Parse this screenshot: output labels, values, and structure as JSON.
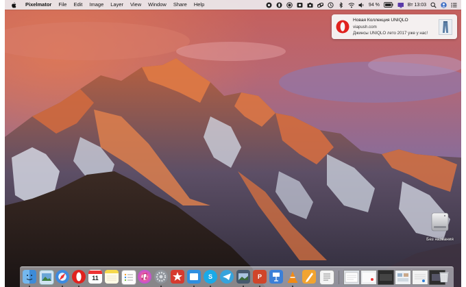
{
  "menubar": {
    "app_name": "Pixelmator",
    "menus": [
      "File",
      "Edit",
      "Image",
      "Layer",
      "View",
      "Window",
      "Share",
      "Help"
    ],
    "battery_text": "94 %",
    "clock": "Вт 13:03",
    "status_icons": [
      "pixelmator-status-icon",
      "opera-status-icon",
      "record-status-icon",
      "photo-booth-status-icon",
      "camera-status-icon",
      "link-status-icon",
      "time-machine-status-icon",
      "bluetooth-status-icon",
      "wifi-status-icon",
      "volume-status-icon",
      "battery-icon",
      "display-icon",
      "search-icon",
      "user-avatar-icon",
      "notification-center-icon"
    ]
  },
  "notification": {
    "app_icon": "opera-icon",
    "title": "Новая Коллекция UNIQLO",
    "subtitle": "viapush.com",
    "body": "Джинсы UNIQLO лето 2017 уже у нас!",
    "image": "jeans-thumbnail-icon"
  },
  "desktop": {
    "disk_label": "Без названия",
    "disk_icon": "hard-disk-icon"
  },
  "dock": {
    "calendar_day": "11",
    "apps": [
      "finder-icon",
      "preview-icon",
      "safari-icon",
      "opera-icon",
      "calendar-icon",
      "notes-icon",
      "reminders-icon",
      "itunes-icon",
      "system-preferences-icon",
      "app-store-icon",
      "flashcard-icon",
      "skype-icon",
      "telegram-icon",
      "photos-icon",
      "powerpoint-icon",
      "keynote-icon",
      "vlc-icon",
      "pages-icon",
      "document-icon",
      "window-1-icon",
      "window-2-icon",
      "window-3-icon",
      "window-4-icon",
      "window-5-icon",
      "window-6-icon",
      "trash-icon"
    ]
  }
}
